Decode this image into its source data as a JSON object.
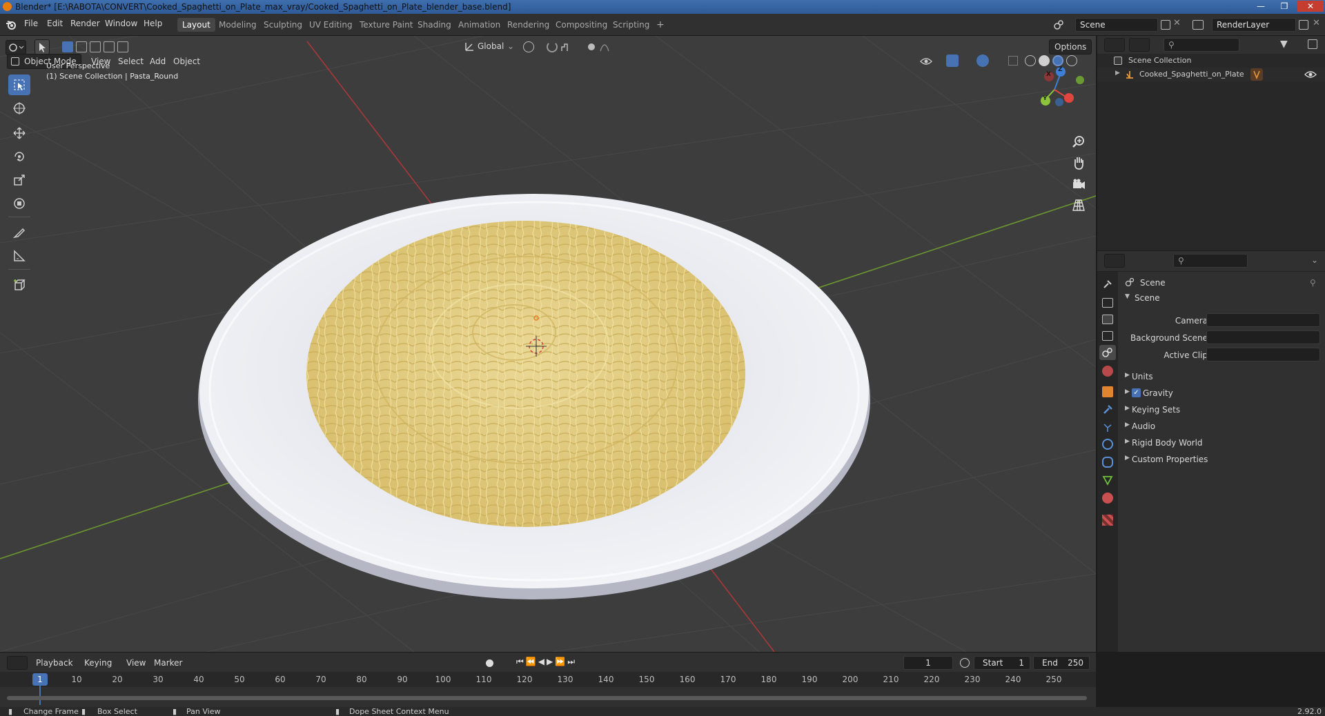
{
  "window": {
    "title": "Blender* [E:\\RABOTA\\CONVERT\\Cooked_Spaghetti_on_Plate_max_vray/Cooked_Spaghetti_on_Plate_blender_base.blend]"
  },
  "menubar": {
    "items": [
      "File",
      "Edit",
      "Render",
      "Window",
      "Help"
    ],
    "workspaces": [
      "Layout",
      "Modeling",
      "Sculpting",
      "UV Editing",
      "Texture Paint",
      "Shading",
      "Animation",
      "Rendering",
      "Compositing",
      "Scripting"
    ],
    "active_workspace": "Layout",
    "add_tab": "+",
    "scene": "Scene",
    "view_layer": "RenderLayer"
  },
  "viewport": {
    "mode": "Object Mode",
    "menus": [
      "View",
      "Select",
      "Add",
      "Object"
    ],
    "transform_orientation": "Global",
    "options_label": "Options",
    "overlay_line1": "User Perspective",
    "overlay_line2": "(1) Scene Collection | Pasta_Round",
    "gizmo_axes": {
      "x": "X",
      "y": "Y",
      "z": "Z"
    }
  },
  "outliner": {
    "root": "Scene Collection",
    "items": [
      {
        "label": "Cooked_Spaghetti_on_Plate"
      }
    ]
  },
  "properties": {
    "breadcrumb": "Scene",
    "section": "Scene",
    "fields": [
      {
        "label": "Camera",
        "value": ""
      },
      {
        "label": "Background Scene",
        "value": ""
      },
      {
        "label": "Active Clip",
        "value": ""
      }
    ],
    "panels": [
      {
        "label": "Units",
        "checkbox": false
      },
      {
        "label": "Gravity",
        "checkbox": true
      },
      {
        "label": "Keying Sets",
        "checkbox": false
      },
      {
        "label": "Audio",
        "checkbox": false
      },
      {
        "label": "Rigid Body World",
        "checkbox": false
      },
      {
        "label": "Custom Properties",
        "checkbox": false
      }
    ]
  },
  "timeline": {
    "menus": [
      "Playback",
      "Keying",
      "View",
      "Marker"
    ],
    "current_frame": "1",
    "start_label": "Start",
    "start": "1",
    "end_label": "End",
    "end": "250",
    "ruler": [
      "10",
      "20",
      "30",
      "40",
      "50",
      "60",
      "70",
      "80",
      "90",
      "100",
      "110",
      "120",
      "130",
      "140",
      "150",
      "160",
      "170",
      "180",
      "190",
      "200",
      "210",
      "220",
      "230",
      "240",
      "250"
    ],
    "playhead": "1"
  },
  "statusbar": {
    "items": [
      "Change Frame",
      "Box Select",
      "Pan View",
      "Dope Sheet Context Menu"
    ],
    "version": "2.92.0"
  },
  "colors": {
    "accent": "#4772b3",
    "x_axis": "#e0453f",
    "y_axis": "#8cc33b",
    "z_axis": "#3d7fd6",
    "plate": "#dfe2ea",
    "pasta": "#e3cf86"
  }
}
